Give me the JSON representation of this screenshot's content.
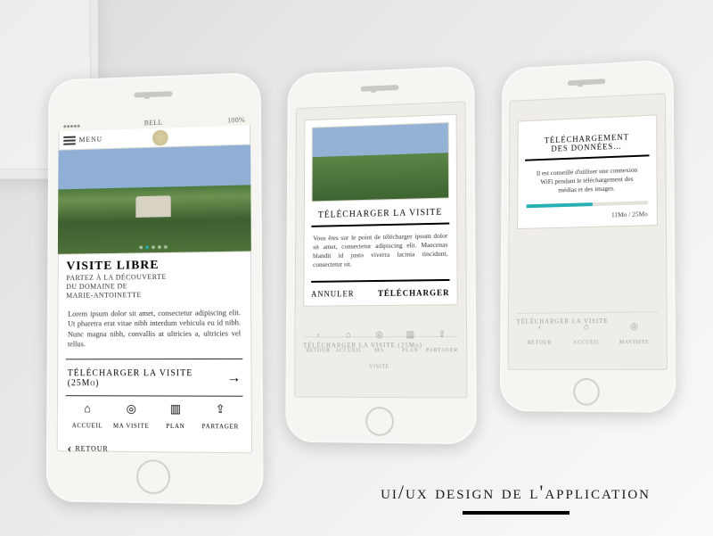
{
  "caption": "ui/ux design de l'application",
  "statusbar": {
    "carrier": "BELL",
    "signal": "●●●●●",
    "battery": "100%"
  },
  "topbar": {
    "menu_label": "MENU"
  },
  "screen1": {
    "title": "VISITE LIBRE",
    "subtitle": "PARTEZ À LA DÉCOUVERTE\nDU DOMAINE DE\nMARIE-ANTOINETTE",
    "lorem": "Lorem ipsum dolor sit amet, consectetur adipiscing elit. Ut pharetra erat vitae nibh interdum vehicula eu id nibh. Nunc magna nibh, convallis at ultricies a, ultricies vel tellus.",
    "download_label": "TÉLÉCHARGER LA VISITE (25Mo)",
    "tabs": {
      "accueil": "ACCUEIL",
      "mavisite": "MA VISITE",
      "plan": "PLAN",
      "partager": "PARTAGER"
    },
    "retour": "RETOUR"
  },
  "screen2": {
    "modal_title": "TÉLÉCHARGER LA VISITE",
    "modal_body": "Vous êtes sur le point de télécharger ipsum dolor sit amet, consectetur adipiscing elit. Maecenas blandit id justo viverra lacinia tincidunt, consectetur sit.",
    "cancel": "ANNULER",
    "confirm": "TÉLÉCHARGER",
    "ghost_dl": "TÉLÉCHARGER LA VISITE (25Mo)",
    "ghost_tabs": {
      "retour": "RETOUR",
      "accueil": "ACCUEIL",
      "mavisite": "MA VISITE",
      "plan": "PLAN",
      "partager": "PARTAGER"
    }
  },
  "screen3": {
    "modal_title": "TÉLÉCHARGEMENT\nDES DONNÉES…",
    "modal_body": "Il est conseillé d'utiliser une connexion WiFi pendant le téléchargement des médias et des images.",
    "progress_text": "11Mo / 25Mo",
    "ghost_dl": "TÉLÉCHARGER LA VISITE",
    "ghost_tabs": {
      "retour": "RETOUR",
      "accueil": "ACCUEIL",
      "mavisite": "MAVISITE"
    }
  }
}
